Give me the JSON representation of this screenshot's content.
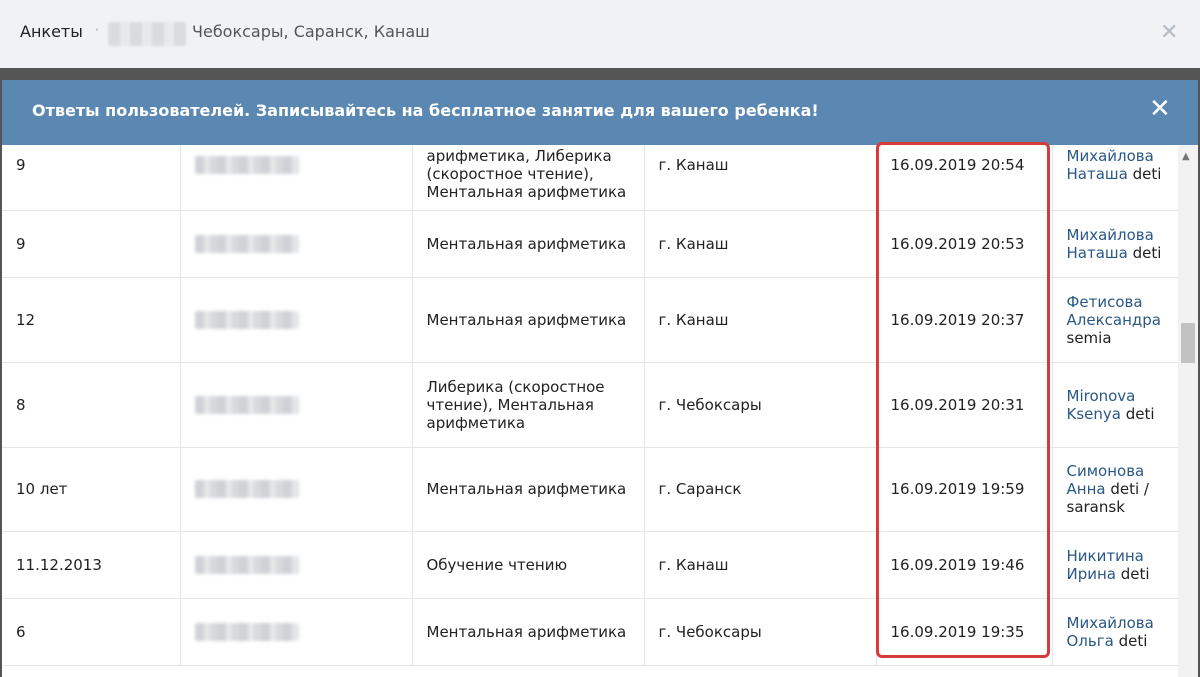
{
  "topbar": {
    "section": "Анкеты",
    "separator": "·",
    "cities": "Чебоксары, Саранск, Канаш",
    "close_icon": "close-icon"
  },
  "modal": {
    "title": "Ответы пользователей. Записывайтесь на бесплатное занятие для вашего ребенка!",
    "close_icon": "close-icon"
  },
  "rows": [
    {
      "age": "9",
      "course": "Ментальная арифметика, Либерика (скоростное чтение), Ментальная арифметика",
      "city": "г. Канаш",
      "datetime": "16.09.2019 20:54",
      "author_name": "Михайлова Наташа",
      "author_tag": " deti"
    },
    {
      "age": "9",
      "course": "Ментальная арифметика",
      "city": "г. Канаш",
      "datetime": "16.09.2019 20:53",
      "author_name": "Михайлова Наташа",
      "author_tag": " deti"
    },
    {
      "age": "12",
      "course": "Ментальная арифметика",
      "city": "г. Канаш",
      "datetime": "16.09.2019 20:37",
      "author_name": "Фетисова Александра",
      "author_tag": " semia"
    },
    {
      "age": "8",
      "course": "Либерика (скоростное чтение), Ментальная арифметика",
      "city": "г. Чебоксары",
      "datetime": "16.09.2019 20:31",
      "author_name": "Mironova Ksenya",
      "author_tag": " deti"
    },
    {
      "age": "10 лет",
      "course": "Ментальная арифметика",
      "city": "г. Саранск",
      "datetime": "16.09.2019 19:59",
      "author_name": "Симонова Анна",
      "author_tag": " deti / saransk"
    },
    {
      "age": "11.12.2013",
      "course": "Обучение чтению",
      "city": "г. Канаш",
      "datetime": "16.09.2019 19:46",
      "author_name": "Никитина Ирина",
      "author_tag": " deti"
    },
    {
      "age": "6",
      "course": "Ментальная арифметика",
      "city": "г. Чебоксары",
      "datetime": "16.09.2019 19:35",
      "author_name": "Михайлова Ольга",
      "author_tag": " deti"
    }
  ],
  "highlight_color": "#d63b3b",
  "header_color": "#5b88b2",
  "link_color": "#2a5885"
}
